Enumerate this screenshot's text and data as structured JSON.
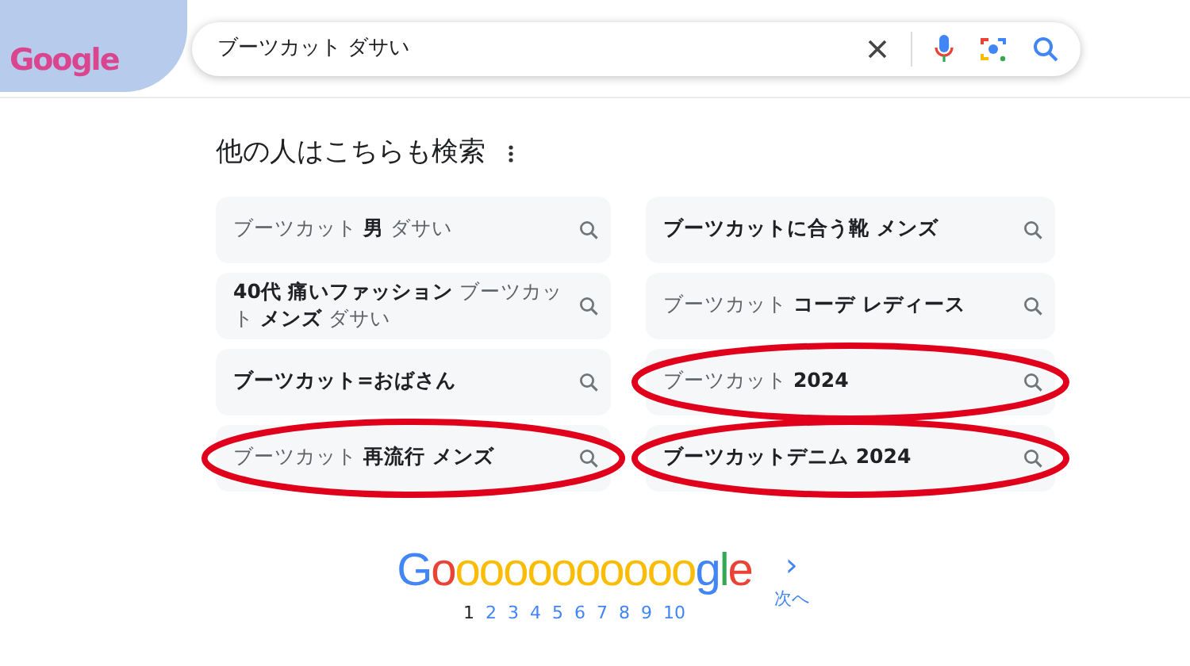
{
  "logo_text": "Google",
  "search": {
    "value": "ブーツカット ダサい"
  },
  "related": {
    "title": "他の人はこちらも検索",
    "items": [
      {
        "text": "ブーツカット **男** ダサい",
        "circled": false
      },
      {
        "text": "**ブーツカットに合う靴 メンズ**",
        "circled": false
      },
      {
        "text": "**40代 痛いファッション** ブーツカット **メンズ** ダサい",
        "circled": false
      },
      {
        "text": "ブーツカット **コーデ レディース**",
        "circled": false
      },
      {
        "text": "**ブーツカット=おばさん**",
        "circled": false
      },
      {
        "text": "ブーツカット **2024**",
        "circled": true
      },
      {
        "text": "ブーツカット **再流行 メンズ**",
        "circled": true
      },
      {
        "text": "**ブーツカットデニム 2024**",
        "circled": true
      }
    ]
  },
  "pager": {
    "logo": "Gooooooooooogle",
    "pages": [
      {
        "label": "1",
        "selected": true
      },
      {
        "label": "2",
        "selected": false
      },
      {
        "label": "3",
        "selected": false
      },
      {
        "label": "4",
        "selected": false
      },
      {
        "label": "5",
        "selected": false
      },
      {
        "label": "6",
        "selected": false
      },
      {
        "label": "7",
        "selected": false
      },
      {
        "label": "8",
        "selected": false
      },
      {
        "label": "9",
        "selected": false
      },
      {
        "label": "10",
        "selected": false
      }
    ],
    "next_arrow": "›",
    "next": "次へ"
  }
}
